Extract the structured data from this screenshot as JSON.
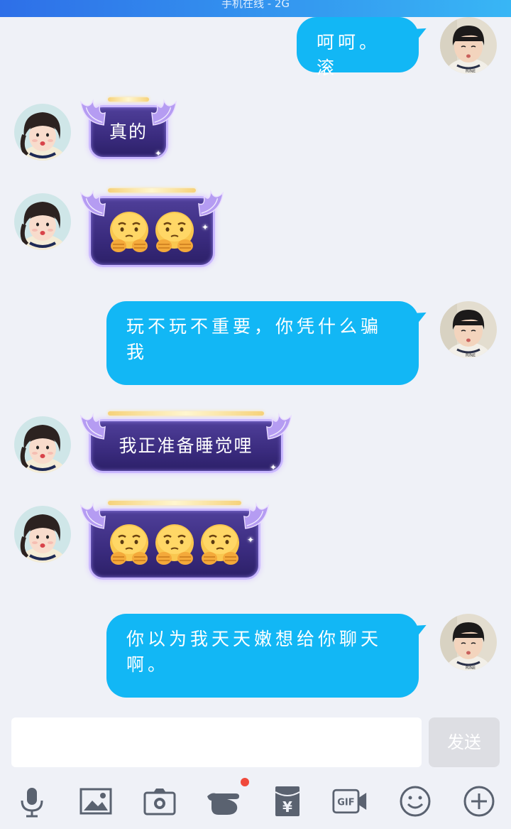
{
  "status_bar": {
    "text": "手机在线 - 2G"
  },
  "messages": [
    {
      "side": "outgoing",
      "text": "呵呵。滚",
      "avatar": "boy-avatar"
    },
    {
      "side": "incoming",
      "text": "真的",
      "avatar": "girl-avatar"
    },
    {
      "side": "incoming",
      "emoji": "worried-face-emoji",
      "count": 2,
      "avatar": "girl-avatar"
    },
    {
      "side": "outgoing",
      "text": "玩不玩不重要，你凭什么骗我",
      "avatar": "boy-avatar"
    },
    {
      "side": "incoming",
      "text": "我正准备睡觉哩",
      "avatar": "girl-avatar"
    },
    {
      "side": "incoming",
      "emoji": "worried-face-emoji",
      "count": 3,
      "avatar": "girl-avatar"
    },
    {
      "side": "outgoing",
      "text": "你以为我天天嫩想给你聊天啊。",
      "avatar": "boy-avatar"
    }
  ],
  "input": {
    "value": "",
    "placeholder": ""
  },
  "send_label": "发送",
  "toolbar": [
    {
      "icon": "microphone-icon"
    },
    {
      "icon": "image-icon"
    },
    {
      "icon": "camera-icon"
    },
    {
      "icon": "poke-hand-icon",
      "badge": "red-dot"
    },
    {
      "icon": "red-packet-icon"
    },
    {
      "icon": "gif-icon"
    },
    {
      "icon": "emoji-icon"
    },
    {
      "icon": "plus-icon"
    }
  ],
  "colors": {
    "outgoing_bubble": "#12b7f5",
    "incoming_bubble": "#3a2b7e",
    "background": "#eff1f7",
    "toolbar_icon": "#5a6270",
    "badge": "#f0493c"
  }
}
